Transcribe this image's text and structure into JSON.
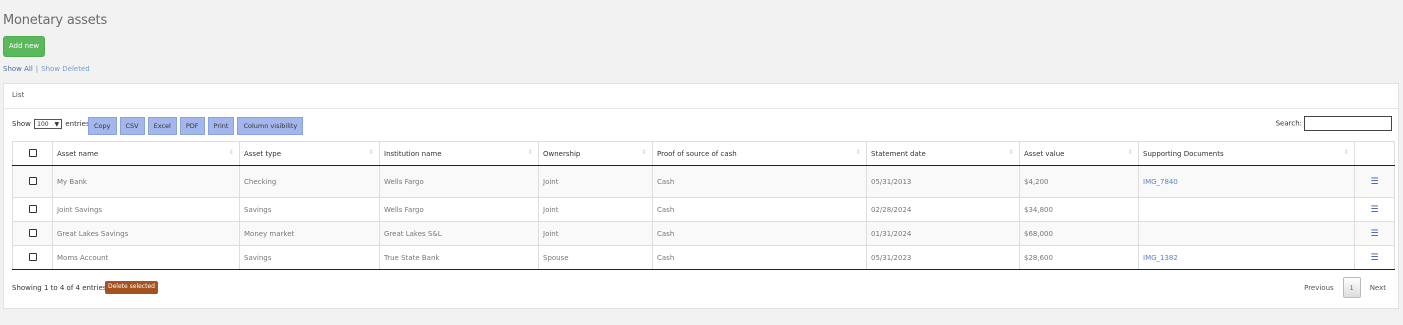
{
  "page": {
    "title": "Monetary assets",
    "add_label": "Add new"
  },
  "filters": {
    "show_all": "Show All",
    "separator": "|",
    "show_deleted": "Show Deleted"
  },
  "panel": {
    "title": "List"
  },
  "controls": {
    "show_label": "Show",
    "length_value": "100",
    "entries_label": "entries",
    "buttons": [
      "Copy",
      "CSV",
      "Excel",
      "PDF",
      "Print",
      "Column visibility"
    ],
    "search_label": "Search:"
  },
  "table": {
    "headers": [
      "Asset name",
      "Asset type",
      "Institution name",
      "Ownership",
      "Proof of source of cash",
      "Statement date",
      "Asset value",
      "Supporting Documents"
    ],
    "rows": [
      [
        "My Bank",
        "Checking",
        "Wells Fargo",
        "Joint",
        "Cash",
        "05/31/2013",
        "$4,200",
        "IMG_7840"
      ],
      [
        "Joint Savings",
        "Savings",
        "Wells Fargo",
        "Joint",
        "Cash",
        "02/28/2024",
        "$34,800",
        ""
      ],
      [
        "Great Lakes Savings",
        "Money market",
        "Great Lakes S&L",
        "Joint",
        "Cash",
        "01/31/2024",
        "$68,000",
        ""
      ],
      [
        "Moms Account",
        "Savings",
        "True State Bank",
        "Spouse",
        "Cash",
        "05/31/2023",
        "$28,600",
        "IMG_1382"
      ]
    ]
  },
  "footer": {
    "info": "Showing 1 to 4 of 4 entries",
    "delete_label": "Delete selected",
    "previous": "Previous",
    "page": "1",
    "next": "Next"
  },
  "icons": {
    "row_menu": "hamburger-menu-icon",
    "sort": "sort-icon"
  }
}
